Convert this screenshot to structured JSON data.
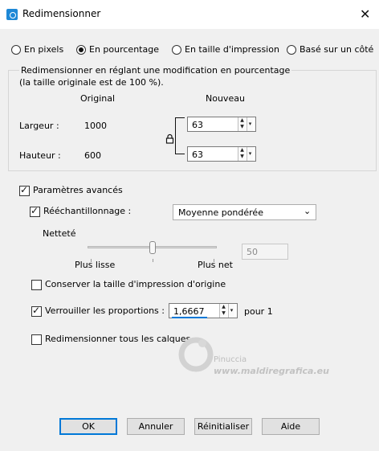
{
  "window": {
    "title": "Redimensionner",
    "close_glyph": "✕"
  },
  "resize_modes": [
    {
      "label": "En pixels",
      "selected": false
    },
    {
      "label": "En pourcentage",
      "selected": true
    },
    {
      "label": "En taille d'impression",
      "selected": false
    },
    {
      "label": "Basé sur un côté",
      "selected": false
    }
  ],
  "group": {
    "description_line1": "Redimensionner en réglant une modification en pourcentage",
    "description_line2": "(la taille originale est de 100 %).",
    "col_original": "Original",
    "col_new": "Nouveau",
    "width_label": "Largeur :",
    "width_original": "1000",
    "width_new": "63",
    "height_label": "Hauteur :",
    "height_original": "600",
    "height_new": "63"
  },
  "advanced": {
    "label": "Paramètres avancés",
    "checked": true,
    "resample_label": "Rééchantillonnage :",
    "resample_checked": true,
    "resample_value": "Moyenne pondérée",
    "sharpness_label": "Netteté",
    "sharpness_min_label": "Plus lisse",
    "sharpness_max_label": "Plus net",
    "sharpness_value": "50",
    "keep_print_size_label": "Conserver la taille d'impression d'origine",
    "keep_print_size_checked": false,
    "lock_ratio_label": "Verrouiller les proportions :",
    "lock_ratio_checked": true,
    "lock_ratio_value": "1,6667",
    "lock_ratio_suffix": "pour 1",
    "resize_all_layers_label": "Redimensionner tous les calques",
    "resize_all_layers_checked": false
  },
  "watermark": {
    "line1": "Pinuccia",
    "line2": "www.maldiregrafica.eu"
  },
  "buttons": {
    "ok": "OK",
    "cancel": "Annuler",
    "reset": "Réinitialiser",
    "help": "Aide"
  },
  "colors": {
    "accent": "#0078d7",
    "title_icon": "#1e88d6"
  }
}
